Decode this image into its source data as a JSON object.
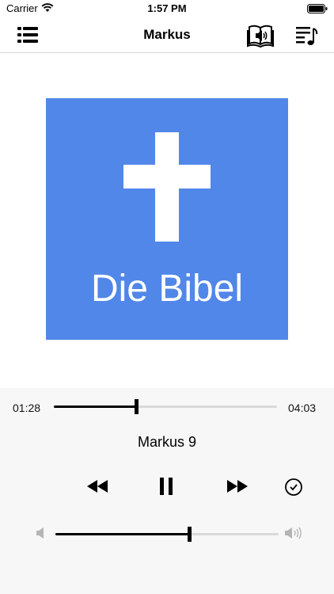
{
  "status_bar": {
    "carrier": "Carrier",
    "time": "1:57 PM"
  },
  "nav": {
    "title": "Markus",
    "left_icon": "list-menu-icon",
    "right_icons": [
      "audio-book-icon",
      "playlist-icon"
    ]
  },
  "artwork": {
    "text": "Die Bibel",
    "background": "#5187e8"
  },
  "player": {
    "elapsed": "01:28",
    "total": "04:03",
    "progress": 0.37,
    "track_title": "Markus 9",
    "volume": 0.6,
    "controls": [
      "rewind-icon",
      "pause-icon",
      "fast-forward-icon",
      "sleep-timer-icon"
    ]
  }
}
